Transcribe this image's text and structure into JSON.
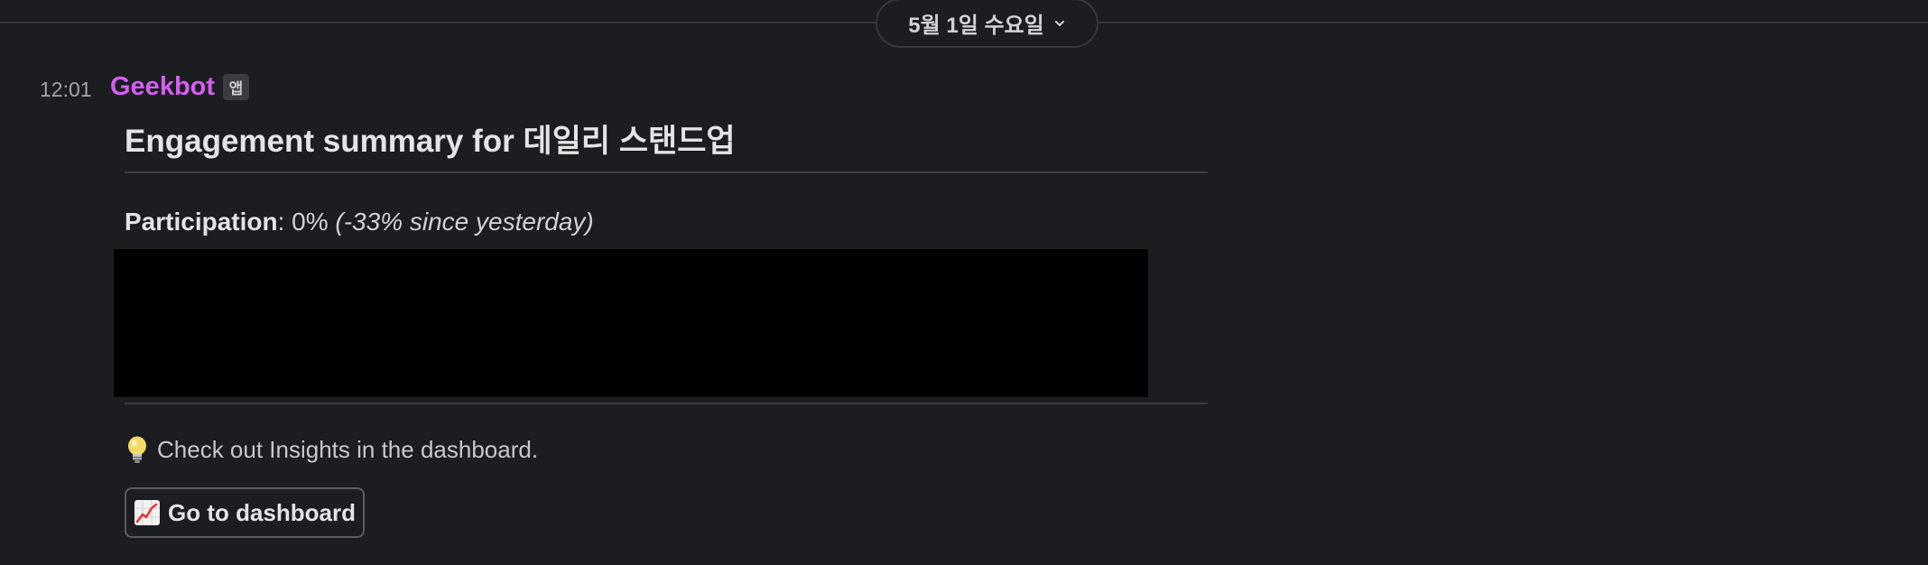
{
  "date_divider": {
    "label": "5월 1일 수요일",
    "icon": "chevron-down-icon"
  },
  "message": {
    "time": "12:01",
    "sender": "Geekbot",
    "badge": "앱",
    "sender_color": "#d65ef0",
    "title": "Engagement summary for 데일리 스탠드업",
    "participation": {
      "label": "Participation",
      "separator": ":",
      "value": " 0% ",
      "delta": "(-33% since yesterday)"
    },
    "tip": {
      "icon": "lightbulb-icon",
      "text": "Check out Insights in the dashboard."
    },
    "button": {
      "icon": "chart-increasing-icon",
      "label": "Go to dashboard"
    }
  }
}
